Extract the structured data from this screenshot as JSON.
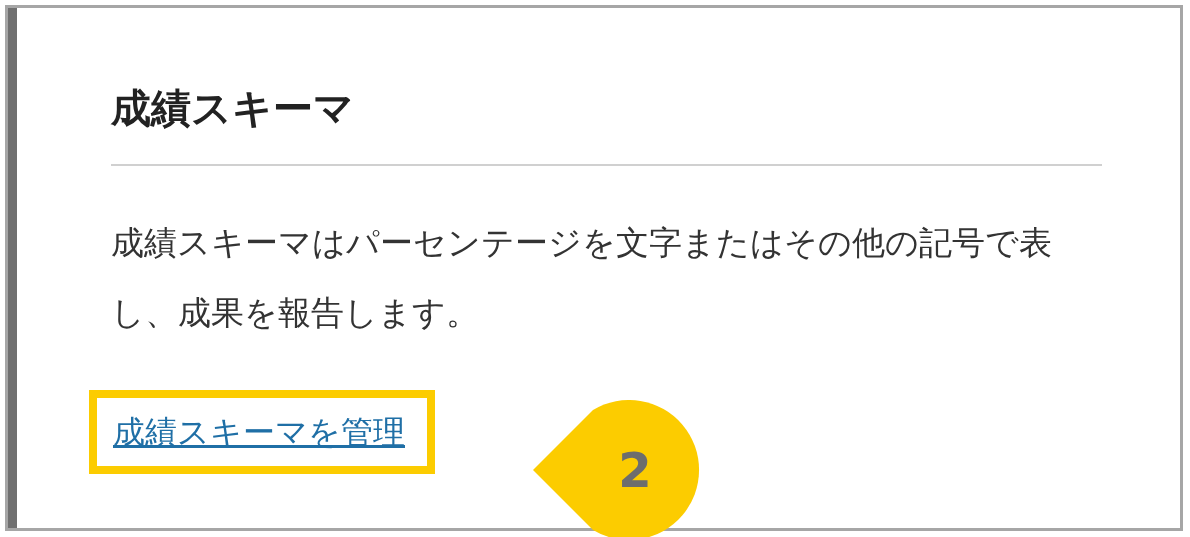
{
  "panel": {
    "title": "成績スキーマ",
    "description": "成績スキーマはパーセンテージを文字またはその他の記号で表し、成果を報告します。",
    "link": {
      "label": "成績スキーマを管理",
      "highlighted": true
    }
  },
  "callout": {
    "number": "2"
  }
}
